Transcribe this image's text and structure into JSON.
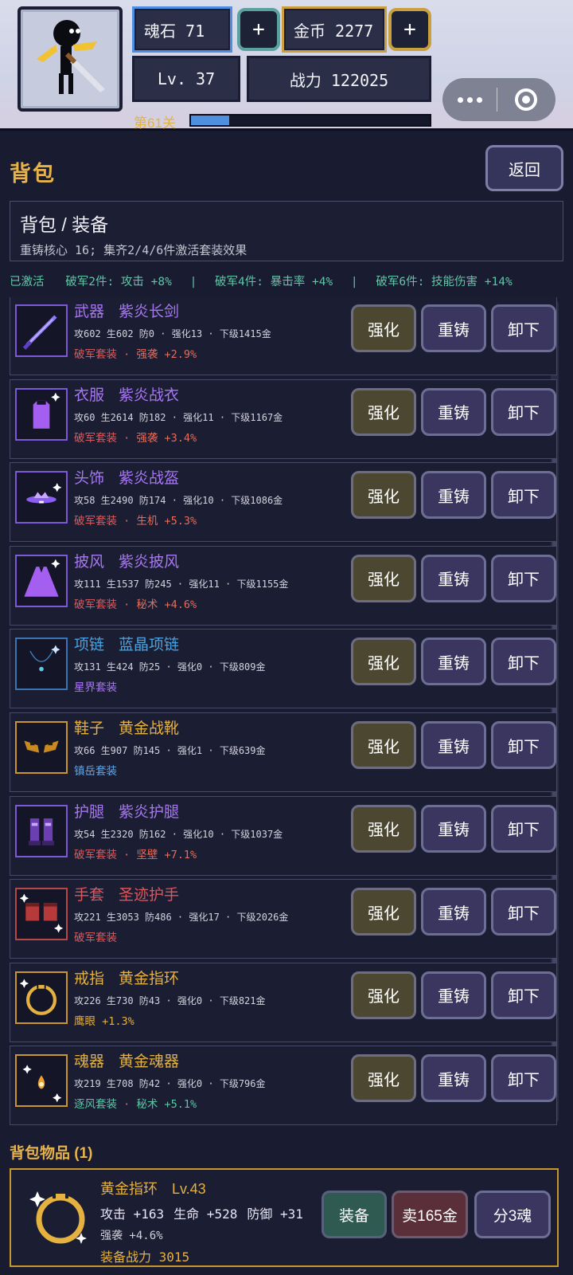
{
  "header": {
    "soul_stone_label": "魂石 71",
    "gold_label": "金币 2277",
    "plus": "+",
    "level": "Lv. 37",
    "power": "战力 122025",
    "stage": "第61关",
    "stage_progress": 0.16
  },
  "page": {
    "title": "背包",
    "back": "返回",
    "breadcrumb": "背包 / 装备",
    "subtitle": "重铸核心 16; 集齐2/4/6件激活套装效果",
    "set_status": {
      "label": "已激活",
      "effects": [
        "破军2件: 攻击 +8%",
        "破军4件: 暴击率 +4%",
        "破军6件: 技能伤害 +14%"
      ],
      "divider": "|"
    }
  },
  "actions": {
    "enhance": "强化",
    "reforge": "重铸",
    "unequip": "卸下"
  },
  "equipment": [
    {
      "slot": "武器",
      "name": "紫炎长剑",
      "stats": "攻602 生602 防0 · 强化13 · 下级1415金",
      "set": "破军套装",
      "bonus": "强袭 +2.9%",
      "quality": "purple",
      "icon": "sword-icon"
    },
    {
      "slot": "衣服",
      "name": "紫炎战衣",
      "stats": "攻60 生2614 防182 · 强化11 · 下级1167金",
      "set": "破军套装",
      "bonus": "强袭 +3.4%",
      "quality": "purple",
      "icon": "armor-icon"
    },
    {
      "slot": "头饰",
      "name": "紫炎战盔",
      "stats": "攻58 生2490 防174 · 强化10 · 下级1086金",
      "set": "破军套装",
      "bonus": "生机 +5.3%",
      "quality": "purple",
      "icon": "helmet-icon"
    },
    {
      "slot": "披风",
      "name": "紫炎披风",
      "stats": "攻111 生1537 防245 · 强化11 · 下级1155金",
      "set": "破军套装",
      "bonus": "秘术 +4.6%",
      "quality": "purple",
      "icon": "cloak-icon"
    },
    {
      "slot": "项链",
      "name": "蓝晶项链",
      "stats": "攻131 生424 防25 · 强化0 · 下级809金",
      "set": "星界套装",
      "bonus": "",
      "quality": "blue",
      "icon": "necklace-icon"
    },
    {
      "slot": "鞋子",
      "name": "黄金战靴",
      "stats": "攻66 生907 防145 · 强化1 · 下级639金",
      "set": "镇岳套装",
      "bonus": "",
      "quality": "gold",
      "icon": "boots-icon"
    },
    {
      "slot": "护腿",
      "name": "紫炎护腿",
      "stats": "攻54 生2320 防162 · 强化10 · 下级1037金",
      "set": "破军套装",
      "bonus": "坚壁 +7.1%",
      "quality": "purple",
      "icon": "leggings-icon"
    },
    {
      "slot": "手套",
      "name": "圣迹护手",
      "stats": "攻221 生3053 防486 · 强化17 · 下级2026金",
      "set": "破军套装",
      "bonus": "",
      "quality": "red",
      "icon": "gloves-icon"
    },
    {
      "slot": "戒指",
      "name": "黄金指环",
      "stats": "攻226 生730 防43 · 强化0 · 下级821金",
      "set": "",
      "bonus": "鹰眼 +1.3%",
      "quality": "gold",
      "icon": "ring-icon"
    },
    {
      "slot": "魂器",
      "name": "黄金魂器",
      "stats": "攻219 生708 防42 · 强化0 · 下级796金",
      "set": "逐风套装",
      "bonus": "秘术 +5.1%",
      "quality": "gold",
      "icon": "soul-orb-icon"
    }
  ],
  "inventory": {
    "title": "背包物品 (1)",
    "item": {
      "name": "黄金指环",
      "level": "Lv.43",
      "atk": "攻击 +163",
      "hp": "生命 +528",
      "def": "防御 +31",
      "extra": "强袭 +4.6%",
      "power": "装备战力 3015",
      "equip": "装备",
      "sell": "卖165金",
      "split": "分3魂",
      "icon": "ring-icon"
    }
  },
  "colors": {
    "purple": "#a777f2",
    "blue": "#4aa3e0",
    "gold": "#e5b13f",
    "red": "#e0555a",
    "set_green": "#5ec6a6",
    "background": "#191b30"
  }
}
